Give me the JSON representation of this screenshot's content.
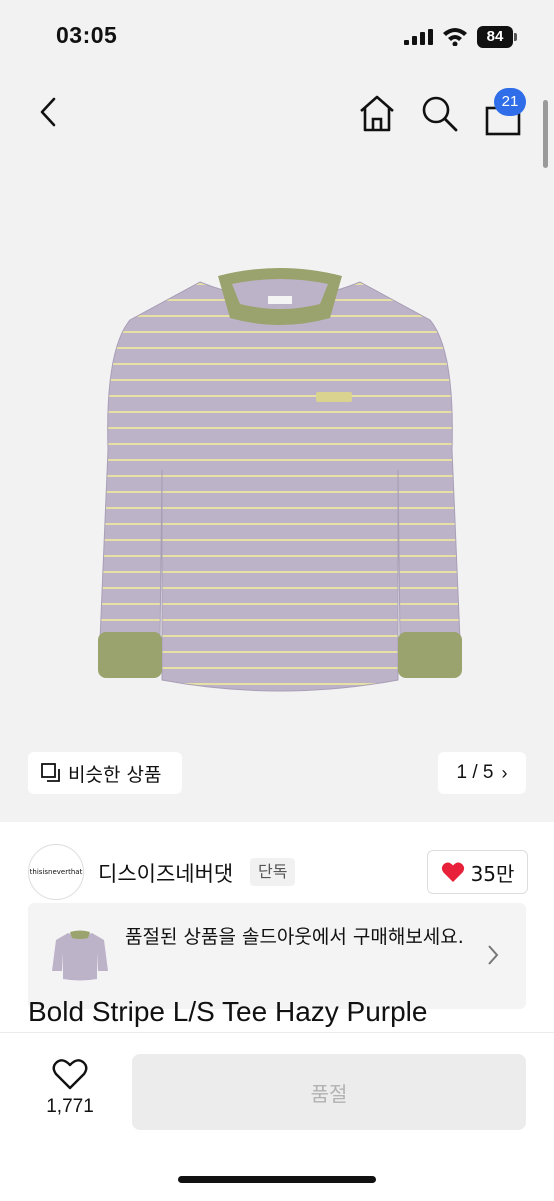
{
  "status_bar": {
    "time": "03:05",
    "battery": "84"
  },
  "header": {
    "cart_count": "21"
  },
  "gallery": {
    "similar_label": "비슷한 상품",
    "pager": "1 / 5"
  },
  "brand": {
    "logo_text": "thisisneverthat",
    "name": "디스이즈네버댓",
    "tag": "단독",
    "likes": "35만"
  },
  "soldout_banner": {
    "text": "품절된 상품을 솔드아웃에서 구매해보세요."
  },
  "product": {
    "title": "Bold Stripe L/S Tee Hazy Purple"
  },
  "bottom_bar": {
    "wish_count": "1,771",
    "buy_button": "품절"
  },
  "colors": {
    "accent": "#2f6ee8",
    "heart": "#e8203a",
    "shirt_body": "#bdb3c9",
    "shirt_trim": "#9aa36d",
    "stripe": "#e6e0a6"
  }
}
